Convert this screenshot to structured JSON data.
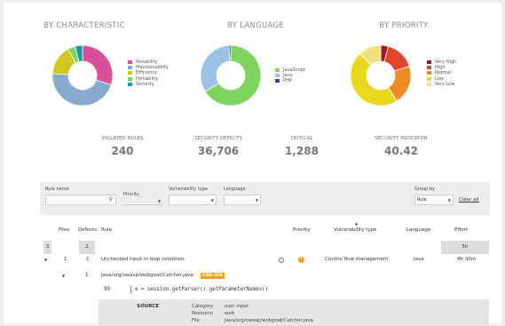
{
  "colors": {
    "pink": "#d94f9a",
    "blue_gray": "#87a9cc",
    "olive": "#d2c71f",
    "green": "#7fd45e",
    "teal": "#1a9aa0",
    "light_blue": "#9cc2e6",
    "navy": "#2f4a8a",
    "dark_red": "#a6162b",
    "red": "#e2462e",
    "orange": "#ef8b23",
    "yellow": "#e9d81c",
    "pale_yellow": "#f2e27d",
    "badge": "#f0a716"
  },
  "charts": {
    "characteristic": {
      "title": "BY CHARACTERISTIC",
      "legend": [
        "Reliability",
        "Maintainability",
        "Efficiency",
        "Portability",
        "Security"
      ]
    },
    "language": {
      "title": "BY LANGUAGE",
      "legend": [
        "JavaScript",
        "Java",
        "PHP"
      ]
    },
    "priority": {
      "title": "BY PRIORITY",
      "legend": [
        "Very High",
        "High",
        "Normal",
        "Low",
        "Very Low"
      ]
    }
  },
  "chart_data": [
    {
      "type": "pie",
      "title": "BY CHARACTERISTIC",
      "categories": [
        "Reliability",
        "Maintainability",
        "Efficiency",
        "Portability",
        "Security"
      ],
      "values": [
        30,
        46,
        16,
        4,
        4
      ],
      "colors": [
        "#d94f9a",
        "#87a9cc",
        "#d2c71f",
        "#7fd45e",
        "#1a9aa0"
      ]
    },
    {
      "type": "pie",
      "title": "BY LANGUAGE",
      "categories": [
        "JavaScript",
        "Java",
        "PHP"
      ],
      "values": [
        66,
        33,
        1
      ],
      "colors": [
        "#7fd45e",
        "#9cc2e6",
        "#2f4a8a"
      ]
    },
    {
      "type": "pie",
      "title": "BY PRIORITY",
      "categories": [
        "Very High",
        "High",
        "Normal",
        "Low",
        "Very Low"
      ],
      "values": [
        4,
        16,
        21,
        47,
        12
      ],
      "colors": [
        "#a6162b",
        "#e2462e",
        "#ef8b23",
        "#e9d81c",
        "#f2e27d"
      ]
    }
  ],
  "metrics": {
    "violated_rules": {
      "label": "VIOLATED RULES",
      "value": "240"
    },
    "security_defects": {
      "label": "SECURITY DEFECTS",
      "value": "36,706"
    },
    "critical": {
      "label": "CRITICAL",
      "value": "1,288"
    },
    "security_indicator": {
      "label": "SECURITY INDICATOR",
      "value": "40.42"
    }
  },
  "filters": {
    "rule_name_label": "Rule name",
    "rule_name_value": "",
    "priority_label": "Priority",
    "vuln_type_label": "Vulnerability type",
    "language_label": "Language",
    "group_by_label": "Group by",
    "group_by_value": "Rule",
    "clear_all": "Clear all"
  },
  "table": {
    "headers": {
      "files": "Files",
      "defects": "Defects",
      "rule": "Rule",
      "priority": "Priority",
      "vuln_type": "Vulnerability type",
      "language": "Language",
      "effort": "Effort"
    },
    "summary": {
      "files": "3",
      "defects": "2",
      "effort": "5h"
    },
    "row": {
      "files": "1",
      "defects": "1",
      "rule": "Unchecked input in loop condition.",
      "priority_glyph": "!",
      "vuln_type": "Control flow management",
      "language": "Java",
      "effort": "4h 30m"
    },
    "file_row": {
      "count": "1",
      "path": "Java/org/owasp/webgoat/Catcher.java",
      "badge": "CWE-606"
    },
    "code": {
      "line_number": "99",
      "text": "e = session.getParser().getParameterNames()"
    },
    "source": {
      "title": "SOURCE",
      "category_key": "Category",
      "category_val": "user input",
      "resource_key": "Resource",
      "resource_val": "web",
      "file_key": "File",
      "file_val": "Java/org/owasp/webgoat/Catcher.java"
    }
  }
}
